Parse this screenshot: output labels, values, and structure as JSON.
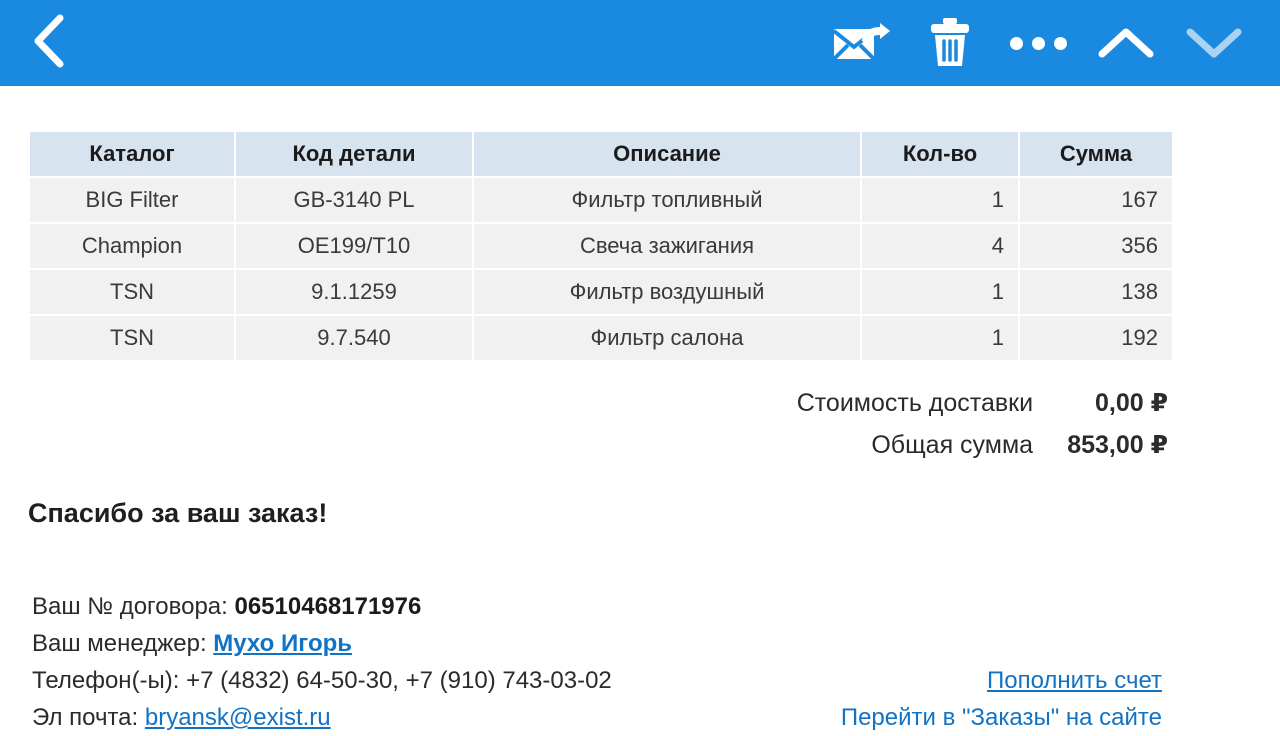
{
  "appbar": {
    "background": "#1a8ae0",
    "back_label": "Back",
    "actions": [
      {
        "name": "reply-icon",
        "label": "Reply"
      },
      {
        "name": "delete-icon",
        "label": "Delete"
      },
      {
        "name": "more-options-icon",
        "label": "More options"
      },
      {
        "name": "previous-message-icon",
        "label": "Previous message"
      },
      {
        "name": "next-message-icon",
        "label": "Next message (disabled)"
      }
    ]
  },
  "table": {
    "headers": [
      "Каталог",
      "Код детали",
      "Описание",
      "Кол-во",
      "Сумма"
    ],
    "rows": [
      {
        "catalog": "BIG Filter",
        "code": "GB-3140 PL",
        "description": "Фильтр топливный",
        "qty": "1",
        "sum": "167"
      },
      {
        "catalog": "Champion",
        "code": "OE199/T10",
        "description": "Свеча зажигания",
        "qty": "4",
        "sum": "356"
      },
      {
        "catalog": "TSN",
        "code": "9.1.1259",
        "description": "Фильтр воздушный",
        "qty": "1",
        "sum": "138"
      },
      {
        "catalog": "TSN",
        "code": "9.7.540",
        "description": "Фильтр салона",
        "qty": "1",
        "sum": "192"
      }
    ]
  },
  "totals": {
    "shipping_label": "Стоимость доставки",
    "shipping_value": "0,00 ₽",
    "grand_label": "Общая сумма",
    "grand_value": "853,00 ₽"
  },
  "thanks": "Спасибо за ваш заказ!",
  "details": {
    "contract_label": "Ваш № договора:",
    "contract_value": "06510468171976",
    "manager_label": "Ваш менеджер:",
    "manager_value": "Мухо Игорь",
    "phone_label": "Телефон(-ы):",
    "phone_value": "+7 (4832) 64-50-30, +7 (910) 743-03-02",
    "email_label": "Эл почта:",
    "email_value": "bryansk@exist.ru",
    "topup_link": "Пополнить счет",
    "orders_link": "Перейти в \"Заказы\" на сайте"
  },
  "colors": {
    "appbar": "#1a8ae0",
    "link": "#1273c4",
    "table_header": "#d7e3ee",
    "table_row": "#f1f1f1"
  }
}
